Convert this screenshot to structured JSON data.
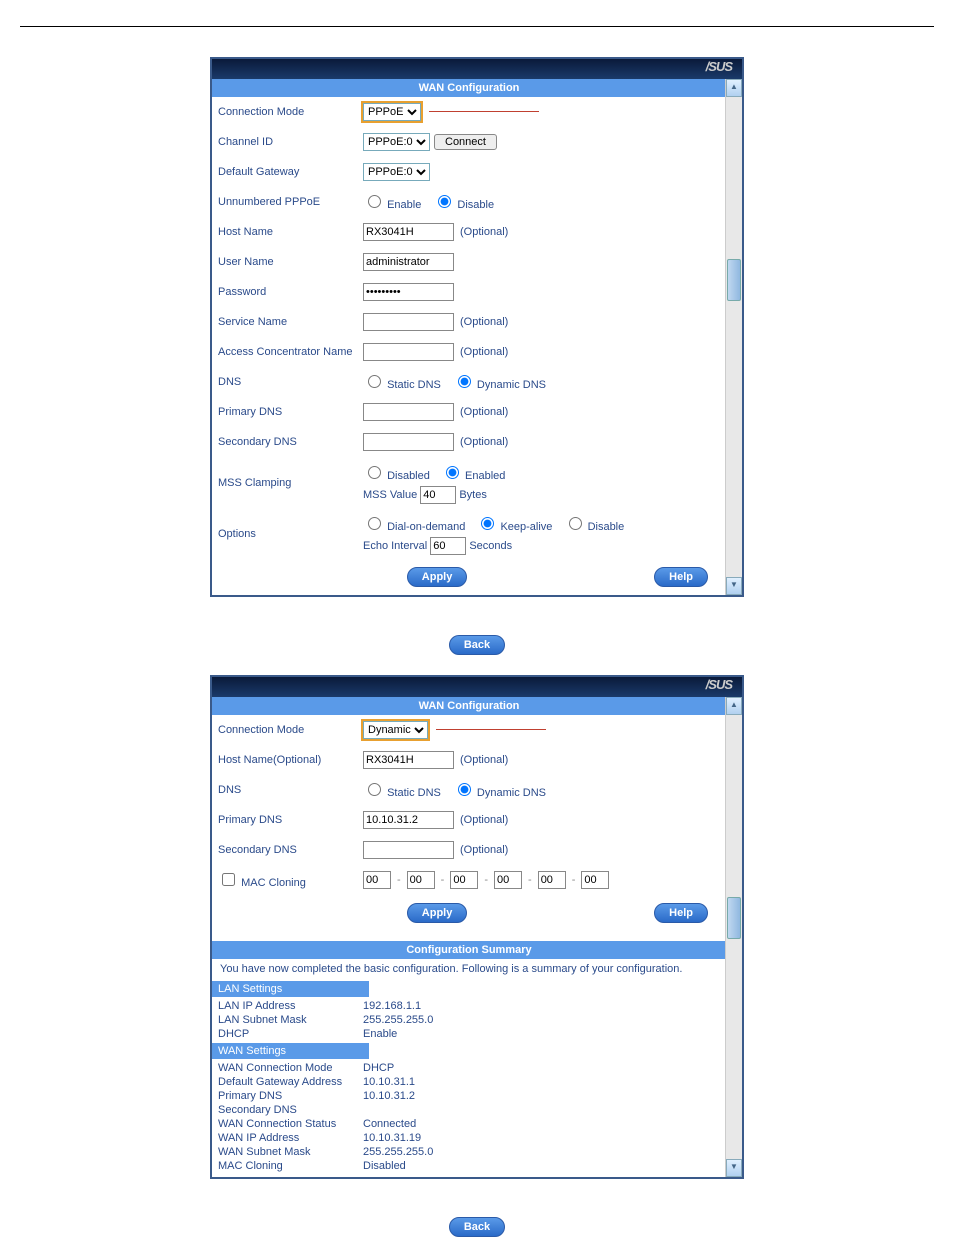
{
  "brand": "/SUS",
  "buttons": {
    "apply": "Apply",
    "help": "Help",
    "back": "Back",
    "connect": "Connect"
  },
  "common": {
    "optional": "(Optional)",
    "bytes": "Bytes",
    "seconds": "Seconds",
    "dash": "-"
  },
  "panel1": {
    "title": "WAN Configuration",
    "rows": {
      "conn_mode": {
        "label": "Connection Mode",
        "value": "PPPoE"
      },
      "channel": {
        "label": "Channel ID",
        "value": "PPPoE:0"
      },
      "gateway": {
        "label": "Default Gateway",
        "value": "PPPoE:0"
      },
      "unnum": {
        "label": "Unnumbered PPPoE",
        "enable": "Enable",
        "disable": "Disable",
        "sel": "disable"
      },
      "host": {
        "label": "Host Name",
        "value": "RX3041H"
      },
      "user": {
        "label": "User Name",
        "value": "administrator"
      },
      "pass": {
        "label": "Password",
        "value": "•••••••••"
      },
      "svc": {
        "label": "Service Name",
        "value": ""
      },
      "acn": {
        "label": "Access Concentrator Name",
        "value": ""
      },
      "dns": {
        "label": "DNS",
        "static": "Static DNS",
        "dynamic": "Dynamic DNS",
        "sel": "dynamic"
      },
      "pdns": {
        "label": "Primary DNS",
        "value": ""
      },
      "sdns": {
        "label": "Secondary DNS",
        "value": ""
      },
      "mss": {
        "label": "MSS Clamping",
        "disabled": "Disabled",
        "enabled": "Enabled",
        "sel": "enabled",
        "valLabel": "MSS Value",
        "value": "40"
      },
      "opt": {
        "label": "Options",
        "dial": "Dial-on-demand",
        "keep": "Keep-alive",
        "disable": "Disable",
        "sel": "keep",
        "echoLabel": "Echo Interval",
        "echo": "60"
      }
    }
  },
  "panel2": {
    "title": "WAN Configuration",
    "rows": {
      "conn_mode": {
        "label": "Connection Mode",
        "value": "Dynamic"
      },
      "host": {
        "label": "Host Name(Optional)",
        "value": "RX3041H"
      },
      "dns": {
        "label": "DNS",
        "static": "Static DNS",
        "dynamic": "Dynamic DNS",
        "sel": "dynamic"
      },
      "pdns": {
        "label": "Primary DNS",
        "value": "10.10.31.2"
      },
      "sdns": {
        "label": "Secondary DNS",
        "value": ""
      },
      "mac": {
        "label": "MAC Cloning",
        "v": [
          "00",
          "00",
          "00",
          "00",
          "00",
          "00"
        ]
      }
    },
    "summary": {
      "title": "Configuration Summary",
      "intro": "You have now completed the basic configuration. Following is a summary of your configuration.",
      "lan_hdr": "LAN Settings",
      "wan_hdr": "WAN Settings",
      "rows": [
        {
          "k": "LAN IP Address",
          "v": "192.168.1.1"
        },
        {
          "k": "LAN Subnet Mask",
          "v": "255.255.255.0"
        },
        {
          "k": "DHCP",
          "v": "Enable"
        }
      ],
      "wrows": [
        {
          "k": "WAN Connection Mode",
          "v": "DHCP"
        },
        {
          "k": "Default Gateway Address",
          "v": "10.10.31.1"
        },
        {
          "k": "Primary DNS",
          "v": "10.10.31.2"
        },
        {
          "k": "Secondary DNS",
          "v": ""
        },
        {
          "k": "WAN Connection Status",
          "v": "Connected"
        },
        {
          "k": "WAN IP Address",
          "v": "10.10.31.19"
        },
        {
          "k": "WAN Subnet Mask",
          "v": "255.255.255.0"
        },
        {
          "k": "MAC Cloning",
          "v": "Disabled"
        }
      ]
    }
  }
}
